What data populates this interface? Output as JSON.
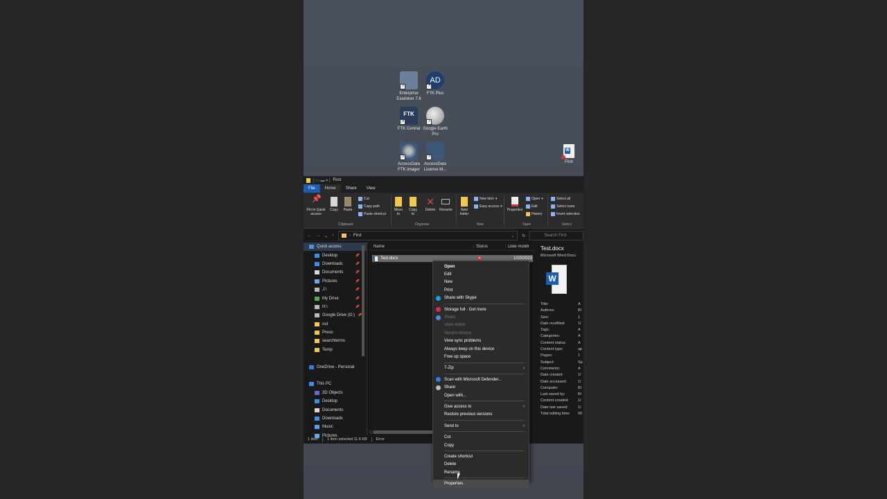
{
  "colors": {
    "accent": "#1a5fb4",
    "folder": "#f3c94b",
    "error": "#d13438",
    "desktop": "#4a5059"
  },
  "desktop_icons": [
    {
      "label": "Enterprise Examiner 7.6",
      "icon": "magnifier-icon"
    },
    {
      "label": "FTK Plus",
      "icon": "ad-logo-icon"
    },
    {
      "label": "FTK Central",
      "icon": "ftk-icon"
    },
    {
      "label": "Google Earth Pro",
      "icon": "globe-icon"
    },
    {
      "label": "AccessData FTK Imager",
      "icon": "disk-icon"
    },
    {
      "label": "AccessData License M...",
      "icon": "license-icon"
    },
    {
      "label": "First",
      "icon": "word-doc-icon"
    }
  ],
  "window": {
    "title": "First",
    "tabs": [
      "File",
      "Home",
      "Share",
      "View"
    ]
  },
  "ribbon": {
    "pin": "Pin to Quick access",
    "copy": "Copy",
    "paste": "Paste",
    "cut": "Cut",
    "copy_path": "Copy path",
    "paste_shortcut": "Paste shortcut",
    "group_clipboard": "Clipboard",
    "move_to": "Move to",
    "copy_to": "Copy to",
    "delete": "Delete",
    "rename": "Rename",
    "group_organize": "Organize",
    "new_folder": "New folder",
    "new_item": "New item",
    "easy_access": "Easy access",
    "group_new": "New",
    "properties": "Properties",
    "open": "Open",
    "edit": "Edit",
    "history": "History",
    "group_open": "Open",
    "select_all": "Select all",
    "select_none": "Select none",
    "invert_selection": "Invert selection",
    "group_select": "Select"
  },
  "address": {
    "path": "First",
    "search_placeholder": "Search First"
  },
  "nav": [
    {
      "label": "Quick access",
      "sel": true,
      "pin": false
    },
    {
      "label": "Desktop",
      "pin": true
    },
    {
      "label": "Downloads",
      "pin": true
    },
    {
      "label": "Documents",
      "pin": true
    },
    {
      "label": "Pictures",
      "pin": true
    },
    {
      "label": "J:\\",
      "pin": true
    },
    {
      "label": "My Drive",
      "pin": true
    },
    {
      "label": "H:\\",
      "pin": true
    },
    {
      "label": "Google Drive (G:)",
      "pin": true
    },
    {
      "label": "out",
      "pin": false
    },
    {
      "label": "Preso",
      "pin": false
    },
    {
      "label": "searchterms",
      "pin": false
    },
    {
      "label": "Temp",
      "pin": false
    },
    {
      "label": "",
      "pin": false
    },
    {
      "label": "OneDrive - Personal",
      "pin": false
    },
    {
      "label": "",
      "pin": false
    },
    {
      "label": "This PC",
      "pin": false
    },
    {
      "label": "3D Objects",
      "pin": false
    },
    {
      "label": "Desktop",
      "pin": false
    },
    {
      "label": "Documents",
      "pin": false
    },
    {
      "label": "Downloads",
      "pin": false
    },
    {
      "label": "Music",
      "pin": false
    },
    {
      "label": "Pictures",
      "pin": false
    }
  ],
  "columns": {
    "name": "Name",
    "status": "Status",
    "date": "Date modifi"
  },
  "file": {
    "name": "Test.docx",
    "date": "1/10/2023"
  },
  "preview": {
    "title": "Test.docx",
    "subtitle": "Microsoft Word Docu",
    "fields": [
      {
        "k": "Title:",
        "v": "A"
      },
      {
        "k": "Authors:",
        "v": "Bl"
      },
      {
        "k": "Size:",
        "v": "1"
      },
      {
        "k": "Date modified:",
        "v": "1/"
      },
      {
        "k": "Tags:",
        "v": "A"
      },
      {
        "k": "Categories:",
        "v": "A"
      },
      {
        "k": "Content status:",
        "v": "A"
      },
      {
        "k": "Content type:",
        "v": "ap"
      },
      {
        "k": "Pages:",
        "v": "1"
      },
      {
        "k": "Subject:",
        "v": "Sp"
      },
      {
        "k": "Comments:",
        "v": "A"
      },
      {
        "k": "Date created:",
        "v": "1/"
      },
      {
        "k": "Date accessed:",
        "v": "1/"
      },
      {
        "k": "Computer:",
        "v": "Bl"
      },
      {
        "k": "Last saved by:",
        "v": "Bl"
      },
      {
        "k": "Content created:",
        "v": "1/"
      },
      {
        "k": "Date last saved:",
        "v": "1/"
      },
      {
        "k": "Total editing time:",
        "v": "00"
      }
    ]
  },
  "statusbar": {
    "count": "1 item",
    "selected": "1 item selected  11.5 KB",
    "state": "Error"
  },
  "context_menu": [
    {
      "label": "Open",
      "bold": true
    },
    {
      "label": "Edit"
    },
    {
      "label": "New"
    },
    {
      "label": "Print"
    },
    {
      "label": "Share with Skype",
      "icon": "skype-icon"
    },
    {
      "sep": true
    },
    {
      "label": "Storage full - Get more",
      "icon": "storage-warning-icon"
    },
    {
      "label": "Share",
      "icon": "onedrive-icon",
      "dis": true
    },
    {
      "label": "View online",
      "dis": true
    },
    {
      "label": "Version history",
      "dis": true
    },
    {
      "label": "View sync problems"
    },
    {
      "label": "Always keep on this device"
    },
    {
      "label": "Free up space"
    },
    {
      "sep": true
    },
    {
      "label": "7-Zip",
      "sub": true
    },
    {
      "sep": true
    },
    {
      "label": "Scan with Microsoft Defender...",
      "icon": "defender-icon"
    },
    {
      "label": "Share",
      "icon": "share-icon"
    },
    {
      "label": "Open with..."
    },
    {
      "sep": true
    },
    {
      "label": "Give access to",
      "sub": true
    },
    {
      "label": "Restore previous versions"
    },
    {
      "sep": true
    },
    {
      "label": "Send to",
      "sub": true
    },
    {
      "sep": true
    },
    {
      "label": "Cut"
    },
    {
      "label": "Copy"
    },
    {
      "sep": true
    },
    {
      "label": "Create shortcut"
    },
    {
      "label": "Delete"
    },
    {
      "label": "Rename"
    },
    {
      "sep": true
    },
    {
      "label": "Properties",
      "hl": true
    }
  ]
}
